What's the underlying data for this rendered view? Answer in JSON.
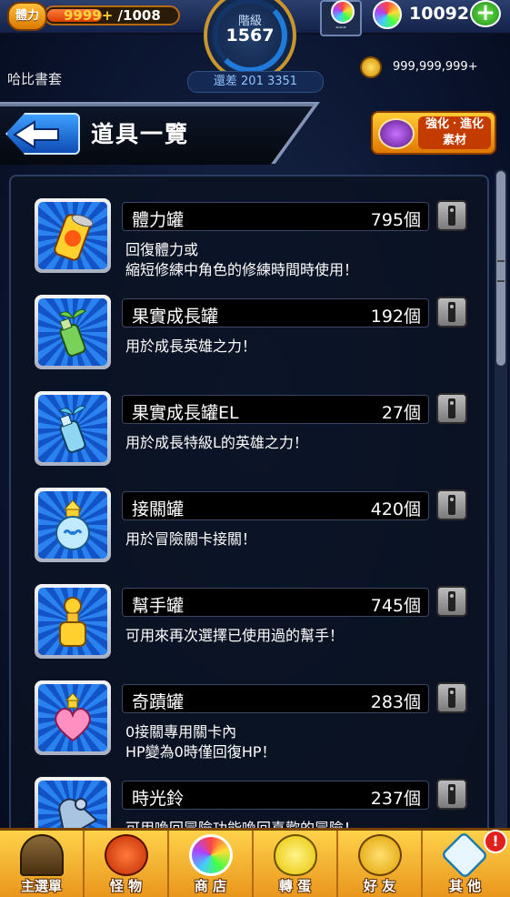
{
  "top": {
    "stamina_label": "體力",
    "stamina_current": "9999+",
    "stamina_max": " /1008",
    "rank_label": "階級",
    "rank_value": "1567",
    "rank_gap": "還差 201 3351",
    "orb_slot_text": "---",
    "orb_count": "10092",
    "owner": "哈比書套",
    "coins": "999,999,999+"
  },
  "header": {
    "title": "道具一覽",
    "enhance_label": "強化ㆍ進化 素材"
  },
  "items": [
    {
      "name": "體力罐",
      "count": "795個",
      "desc": "回復體力或\n縮短修練中角色的修練時間時使用！",
      "icon": "stamina-can-icon"
    },
    {
      "name": "果實成長罐",
      "count": "192個",
      "desc": "用於成長英雄之力！",
      "icon": "fruit-growth-bottle-icon"
    },
    {
      "name": "果實成長罐EL",
      "count": "27個",
      "desc": "用於成長特級L的英雄之力！",
      "icon": "fruit-growth-bottle-el-icon"
    },
    {
      "name": "接關罐",
      "count": "420個",
      "desc": "用於冒險關卡接關！",
      "icon": "continue-jar-icon"
    },
    {
      "name": "幫手罐",
      "count": "745個",
      "desc": "可用來再次選擇已使用過的幫手！",
      "icon": "helper-jar-icon"
    },
    {
      "name": "奇蹟罐",
      "count": "283個",
      "desc": "0接關專用關卡內\nHP變為0時僅回復HP！",
      "icon": "miracle-jar-icon"
    },
    {
      "name": "時光鈴",
      "count": "237個",
      "desc": "可用喚回冒險功能喚回喜歡的冒險！",
      "icon": "time-bell-icon"
    }
  ],
  "nav": [
    {
      "label": "主選單",
      "icon": "home-gate-icon"
    },
    {
      "label": "怪 物",
      "icon": "monster-icon"
    },
    {
      "label": "商 店",
      "icon": "rainbow-orb-icon"
    },
    {
      "label": "轉 蛋",
      "icon": "egg-icon"
    },
    {
      "label": "好 友",
      "icon": "friends-icon"
    },
    {
      "label": "其 他",
      "icon": "question-icon"
    }
  ],
  "nav_alert": "!",
  "colors": {
    "accent": "#2a82f0",
    "nav": "#ffd24a"
  }
}
